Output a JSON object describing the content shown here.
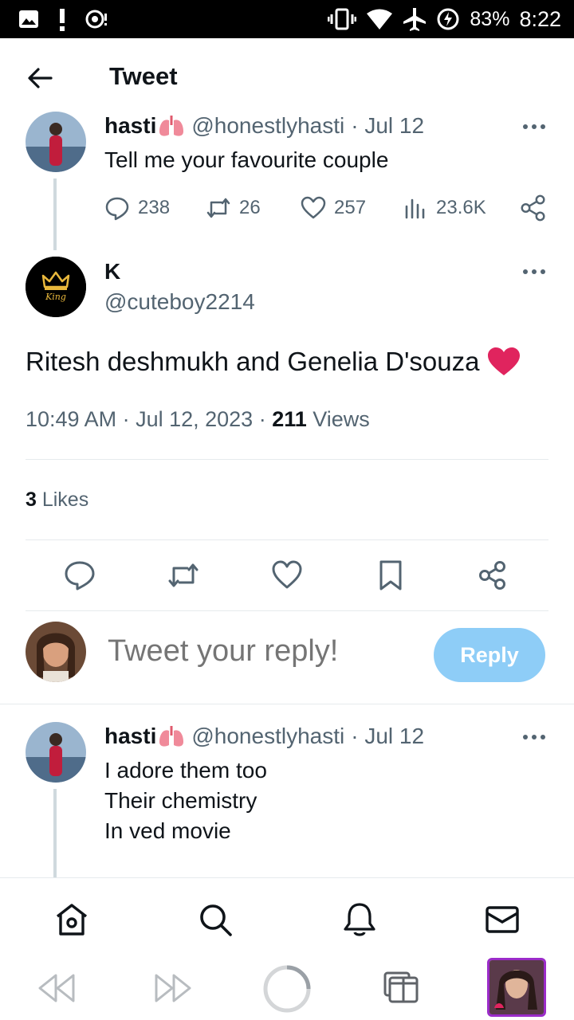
{
  "status_bar": {
    "battery": "83%",
    "time": "8:22"
  },
  "header": {
    "title": "Tweet"
  },
  "parent_tweet": {
    "name": "hasti",
    "handle": "@honestlyhasti",
    "date": "· Jul 12",
    "text": "Tell me your favourite couple",
    "replies": "238",
    "retweets": "26",
    "likes": "257",
    "views": "23.6K"
  },
  "main_tweet": {
    "name": "K",
    "handle": "@cuteboy2214",
    "avatar_text": "King",
    "text": "Ritesh deshmukh and Genelia D'souza",
    "timestamp": "10:49 AM · Jul 12, 2023 · ",
    "views_count": "211",
    "views_label": " Views",
    "likes_count": "3",
    "likes_label": " Likes"
  },
  "reply_box": {
    "placeholder": "Tweet your reply!",
    "button": "Reply"
  },
  "reply_tweet": {
    "name": "hasti",
    "handle": "@honestlyhasti",
    "date": "· Jul 12",
    "line1": "I adore them too",
    "line2": "Their chemistry",
    "line3": "In ved movie"
  },
  "colors": {
    "accent": "#1d9bf0",
    "reply_button_disabled": "#8ecdf7",
    "heart_red": "#e0245e",
    "muted_text": "#536471"
  }
}
